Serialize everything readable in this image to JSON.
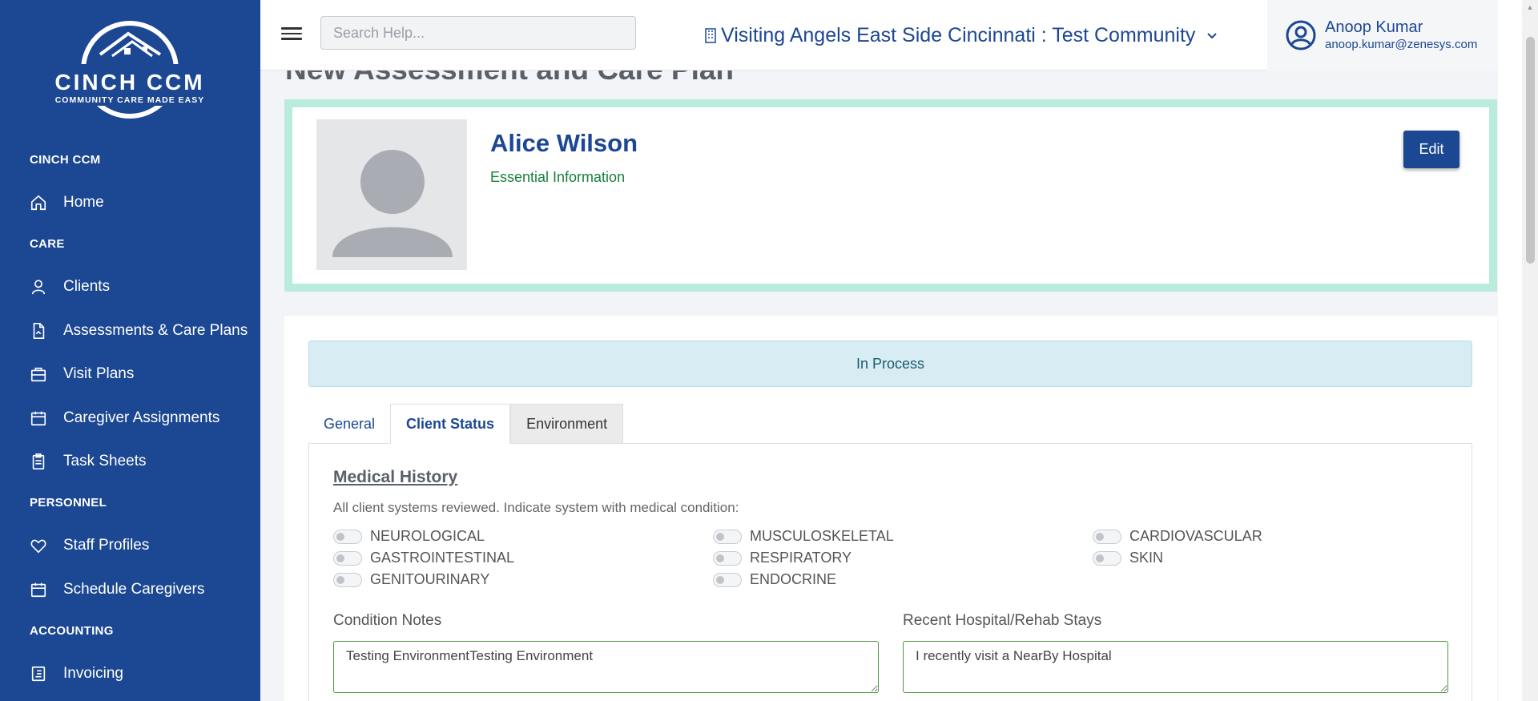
{
  "brand": {
    "name": "CINCH CCM",
    "tagline": "COMMUNITY CARE MADE EASY"
  },
  "sidebar": {
    "sections": [
      {
        "label": "CINCH CCM"
      },
      {
        "label": "CARE"
      },
      {
        "label": "PERSONNEL"
      },
      {
        "label": "ACCOUNTING"
      }
    ],
    "items": [
      {
        "label": "Home",
        "icon": "home-icon"
      },
      {
        "label": "Clients",
        "icon": "user-icon"
      },
      {
        "label": "Assessments & Care Plans",
        "icon": "document-icon"
      },
      {
        "label": "Visit Plans",
        "icon": "briefcase-icon"
      },
      {
        "label": "Caregiver Assignments",
        "icon": "calendar-icon"
      },
      {
        "label": "Task Sheets",
        "icon": "clipboard-icon"
      },
      {
        "label": "Staff Profiles",
        "icon": "heart-icon"
      },
      {
        "label": "Schedule Caregivers",
        "icon": "calendar-icon"
      },
      {
        "label": "Invoicing",
        "icon": "invoice-icon"
      }
    ]
  },
  "header": {
    "search_placeholder": "Search Help...",
    "community": "Visiting Angels East Side Cincinnati : Test Community",
    "user_name": "Anoop Kumar",
    "user_email": "anoop.kumar@zenesys.com"
  },
  "page": {
    "title": "New Assessment and Care Plan"
  },
  "client": {
    "name": "Alice Wilson",
    "essential_info": "Essential Information",
    "edit_label": "Edit"
  },
  "status": "In Process",
  "tabs": [
    {
      "label": "General"
    },
    {
      "label": "Client Status"
    },
    {
      "label": "Environment"
    }
  ],
  "medical_history": {
    "title": "Medical History",
    "description": "All client systems reviewed. Indicate system with medical condition:",
    "systems": [
      {
        "label": "NEUROLOGICAL",
        "checked": false
      },
      {
        "label": "GASTROINTESTINAL",
        "checked": false
      },
      {
        "label": "GENITOURINARY",
        "checked": false
      },
      {
        "label": "MUSCULOSKELETAL",
        "checked": false
      },
      {
        "label": "RESPIRATORY",
        "checked": false
      },
      {
        "label": "ENDOCRINE",
        "checked": false
      },
      {
        "label": "CARDIOVASCULAR",
        "checked": false
      },
      {
        "label": "SKIN",
        "checked": false
      }
    ]
  },
  "condition_notes": {
    "label": "Condition Notes",
    "value": "Testing EnvironmentTesting Environment"
  },
  "hospital_stays": {
    "label": "Recent Hospital/Rehab Stays",
    "value": "I recently visit a NearBy Hospital"
  }
}
